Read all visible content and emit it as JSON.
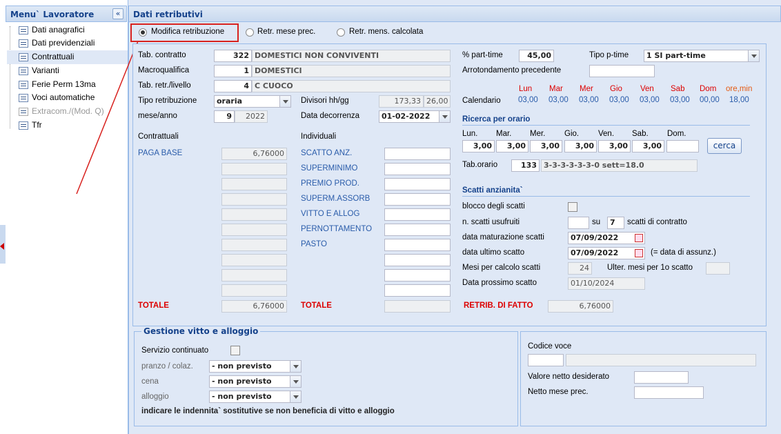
{
  "sidebar": {
    "title": "Menu` Lavoratore",
    "collapse_icon": "«",
    "items": [
      {
        "label": "Dati anagrafici",
        "selected": false,
        "disabled": false
      },
      {
        "label": "Dati previdenziali",
        "selected": false,
        "disabled": false
      },
      {
        "label": "Contrattuali",
        "selected": true,
        "disabled": false
      },
      {
        "label": "Varianti",
        "selected": false,
        "disabled": false
      },
      {
        "label": "Ferie Perm 13ma",
        "selected": false,
        "disabled": false
      },
      {
        "label": "Voci automatiche",
        "selected": false,
        "disabled": false
      },
      {
        "label": "Extracom./(Mod. Q)",
        "selected": false,
        "disabled": true
      },
      {
        "label": "Tfr",
        "selected": false,
        "disabled": false
      }
    ]
  },
  "main": {
    "title": "Dati retributivi",
    "radios": [
      {
        "label": "Modifica retribuzione",
        "checked": true
      },
      {
        "label": "Retr. mese prec.",
        "checked": false
      },
      {
        "label": "Retr. mens. calcolata",
        "checked": false
      }
    ],
    "left": {
      "tab_contratto": {
        "label": "Tab. contratto",
        "code": "322",
        "desc": "DOMESTICI NON CONVIVENTI"
      },
      "macroqualifica": {
        "label": "Macroqualifica",
        "code": "1",
        "desc": "DOMESTICI"
      },
      "tab_retr": {
        "label": "Tab. retr./livello",
        "code": "4",
        "desc": "C CUOCO"
      },
      "tipo_retribuzione": {
        "label": "Tipo retribuzione",
        "value": "oraria"
      },
      "divisori": {
        "label": "Divisori hh/gg",
        "hh": "173,33",
        "gg": "26,00"
      },
      "mese_anno": {
        "label": "mese/anno",
        "mese": "9",
        "anno": "2022"
      },
      "data_decorrenza": {
        "label": "Data decorrenza",
        "value": "01-02-2022"
      },
      "contrattuali_head": "Contrattuali",
      "individuali_head": "Individuali",
      "paga_base": {
        "label": "PAGA BASE",
        "value": "6,76000"
      },
      "individuali": [
        "SCATTO ANZ.",
        "SUPERMINIMO",
        "PREMIO PROD.",
        "SUPERM.ASSORB",
        "VITTO E ALLOG",
        "PERNOTTAMENTO",
        "PASTO"
      ],
      "totale_label": "TOTALE",
      "totale_contr": "6,76000",
      "totale_ind_label": "TOTALE",
      "totale_ind": ""
    },
    "right": {
      "part_time": {
        "label": "% part-time",
        "value": "45,00"
      },
      "tipo_ptime": {
        "label": "Tipo p-time",
        "value": "1 SI part-time"
      },
      "arrotondamento": {
        "label": "Arrotondamento precedente",
        "value": ""
      },
      "calendario": {
        "label": "Calendario",
        "days": [
          "Lun",
          "Mar",
          "Mer",
          "Gio",
          "Ven",
          "Sab",
          "Dom"
        ],
        "values": [
          "03,00",
          "03,00",
          "03,00",
          "03,00",
          "03,00",
          "03,00",
          "00,00"
        ],
        "total_label": "ore,min",
        "total": "18,00"
      },
      "ricerca": {
        "title": "Ricerca per orario",
        "days": [
          "Lun.",
          "Mar.",
          "Mer.",
          "Gio.",
          "Ven.",
          "Sab.",
          "Dom."
        ],
        "values": [
          "3,00",
          "3,00",
          "3,00",
          "3,00",
          "3,00",
          "3,00",
          ""
        ],
        "button": "cerca",
        "tab_orario_label": "Tab.orario",
        "tab_orario_code": "133",
        "tab_orario_desc": "3-3-3-3-3-3-0 sett=18.0"
      },
      "scatti": {
        "title": "Scatti anzianita`",
        "blocco_label": "blocco degli scatti",
        "n_scatti_label": "n. scatti usufruiti",
        "n_scatti": "",
        "su_label": "su",
        "su_value": "7",
        "di_contratto": "scatti di contratto",
        "data_mat_label": "data maturazione scatti",
        "data_mat": "07/09/2022",
        "data_ult_label": "data ultimo scatto",
        "data_ult": "07/09/2022",
        "data_ult_note": "(= data di assunz.)",
        "mesi_label": "Mesi per calcolo scatti",
        "mesi": "24",
        "ulter_label": "Ulter. mesi per 1o scatto",
        "ulter": "",
        "prossimo_label": "Data prossimo scatto",
        "prossimo": "01/10/2024"
      },
      "retrib_fatto_label": "RETRIB. DI FATTO",
      "retrib_fatto": "6,76000"
    },
    "vitto": {
      "title": "Gestione vitto e alloggio",
      "servizio_label": "Servizio continuato",
      "pranzo_label": "pranzo / colaz.",
      "pranzo": "- non previsto",
      "cena_label": "cena",
      "cena": "- non previsto",
      "alloggio_label": "alloggio",
      "alloggio": "- non previsto",
      "note": "indicare le indennita` sostitutive se non beneficia di vitto e alloggio"
    },
    "voce": {
      "codice_label": "Codice voce",
      "codice": "",
      "codice_desc": "",
      "valore_label": "Valore netto desiderato",
      "valore": "",
      "netto_label": "Netto mese prec.",
      "netto": ""
    }
  },
  "colors": {
    "accent": "#15428b",
    "highlight": "#d8221f",
    "label_blue": "#2a5caa",
    "orange": "#e45a12"
  }
}
